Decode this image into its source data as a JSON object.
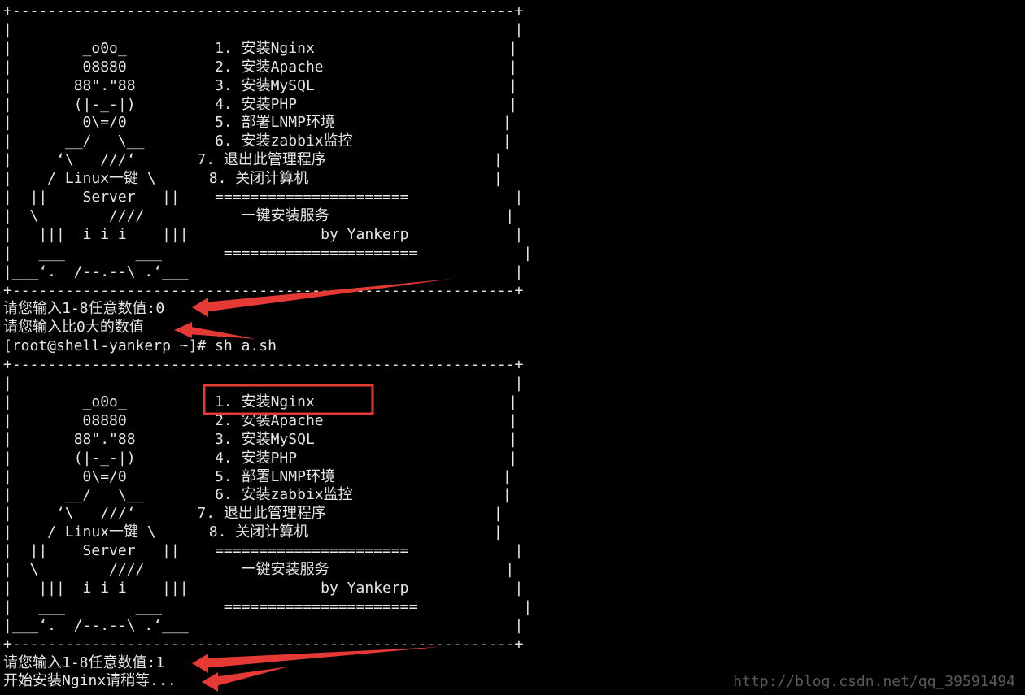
{
  "terminal": {
    "lines": [
      "+---------------------------------------------------------+",
      "|                                                         |",
      "|        _o0o_          1. 安装Nginx                      |",
      "|        08880          2. 安装Apache                     |",
      "|       88\".\"88         3. 安装MySQL                      |",
      "|       (|-_-|)         4. 安装PHP                        |",
      "|        0\\=/0          5. 部署LNMP环境                   |",
      "|      __/   \\__        6. 安装zabbix监控                 |",
      "|     ‘\\   ///‘       7. 退出此管理程序                   |",
      "|    / Linux一键 \\      8. 关闭计算机                     |",
      "|  ||    Server   ||    ======================            |",
      "|  \\        ////           一键安装服务                    |",
      "|   |||  i i i    |||               by Yankerp            |",
      "|   ___        ___       ======================            |",
      "|___‘.  /--.--\\ .‘___                                     |",
      "+---------------------------------------------------------+",
      "请您输入1-8任意数值:0",
      "请您输入比0大的数值",
      "[root@shell-yankerp ~]# sh a.sh",
      "+---------------------------------------------------------+",
      "|                                                         |",
      "|        _o0o_          1. 安装Nginx                      |",
      "|        08880          2. 安装Apache                     |",
      "|       88\".\"88         3. 安装MySQL                      |",
      "|       (|-_-|)         4. 安装PHP                        |",
      "|        0\\=/0          5. 部署LNMP环境                   |",
      "|      __/   \\__        6. 安装zabbix监控                 |",
      "|     ‘\\   ///‘       7. 退出此管理程序                   |",
      "|    / Linux一键 \\      8. 关闭计算机                     |",
      "|  ||    Server   ||    ======================            |",
      "|  \\        ////           一键安装服务                    |",
      "|   |||  i i i    |||               by Yankerp            |",
      "|   ___        ___       ======================            |",
      "|___‘.  /--.--\\ .‘___                                     |",
      "+---------------------------------------------------------+",
      "请您输入1-8任意数值:1",
      "开始安装Nginx请稍等..."
    ]
  },
  "watermark": "http://blog.csdn.net/qq_39591494",
  "colors": {
    "background": "#000000",
    "text": "#e6e6e6",
    "annotation": "#e53935"
  }
}
